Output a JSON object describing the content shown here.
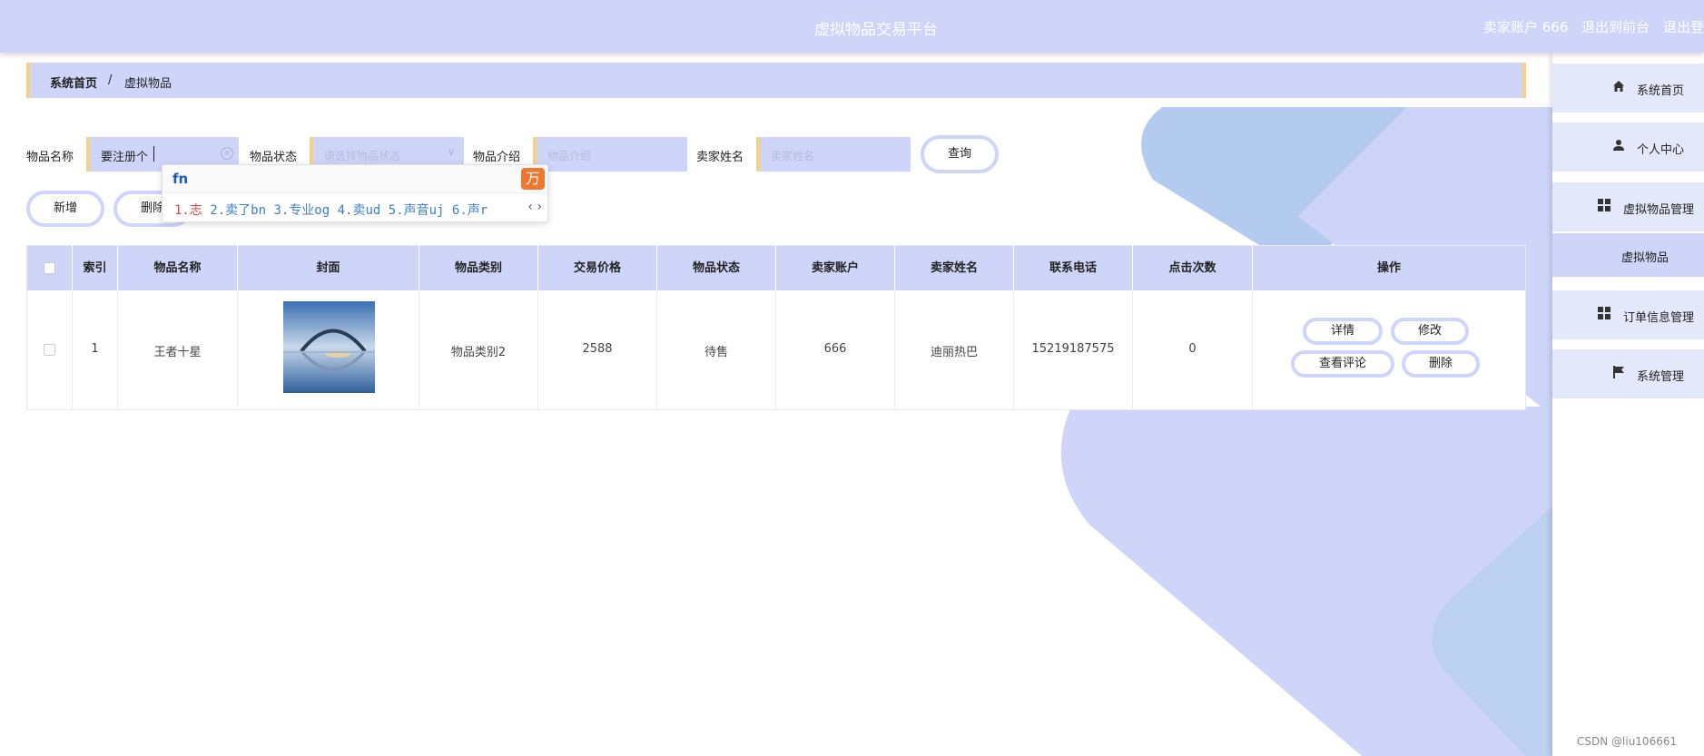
{
  "header": {
    "title": "虚拟物品交易平台",
    "user": "卖家账户 666",
    "back_to_front": "退出到前台",
    "logout": "退出登"
  },
  "breadcrumb": {
    "home": "系统首页",
    "separator": "/",
    "current": "虚拟物品"
  },
  "search": {
    "name_label": "物品名称",
    "name_value": "要注册个",
    "status_label": "物品状态",
    "status_placeholder": "请选择物品状态",
    "intro_label": "物品介绍",
    "intro_placeholder": "物品介绍",
    "seller_label": "卖家姓名",
    "seller_placeholder": "卖家姓名",
    "query_button": "查询"
  },
  "actions": {
    "add": "新增",
    "delete": "删除"
  },
  "ime": {
    "composition": "fn",
    "candidates": [
      {
        "num": "1.",
        "text": "志"
      },
      {
        "num": "2.",
        "text": "卖了bn"
      },
      {
        "num": "3.",
        "text": "专业og"
      },
      {
        "num": "4.",
        "text": "卖ud"
      },
      {
        "num": "5.",
        "text": "声音uj"
      },
      {
        "num": "6.",
        "text": "声r"
      }
    ],
    "logo": "万"
  },
  "table": {
    "headers": [
      "索引",
      "物品名称",
      "封面",
      "物品类别",
      "交易价格",
      "物品状态",
      "卖家账户",
      "卖家姓名",
      "联系电话",
      "点击次数",
      "操作"
    ],
    "rows": [
      {
        "index": "1",
        "name": "王者十星",
        "category": "物品类别2",
        "price": "2588",
        "status": "待售",
        "seller_account": "666",
        "seller_name": "迪丽热巴",
        "phone": "15219187575",
        "clicks": "0",
        "ops": {
          "detail": "详情",
          "edit": "修改",
          "comments": "查看评论",
          "delete": "删除"
        }
      }
    ]
  },
  "sidebar": {
    "items": [
      {
        "label": "系统首页",
        "icon": "home-icon"
      },
      {
        "label": "个人中心",
        "icon": "user-icon"
      },
      {
        "label": "虚拟物品管理",
        "icon": "grid-icon"
      },
      {
        "label": "虚拟物品",
        "icon": ""
      },
      {
        "label": "订单信息管理",
        "icon": "grid-icon"
      },
      {
        "label": "系统管理",
        "icon": "flag-icon"
      }
    ]
  },
  "watermark": "CSDN @liu106661",
  "colors": {
    "primary_light": "#ced5f9",
    "accent": "#f7d180",
    "menu_bg": "#e4e8fb"
  }
}
